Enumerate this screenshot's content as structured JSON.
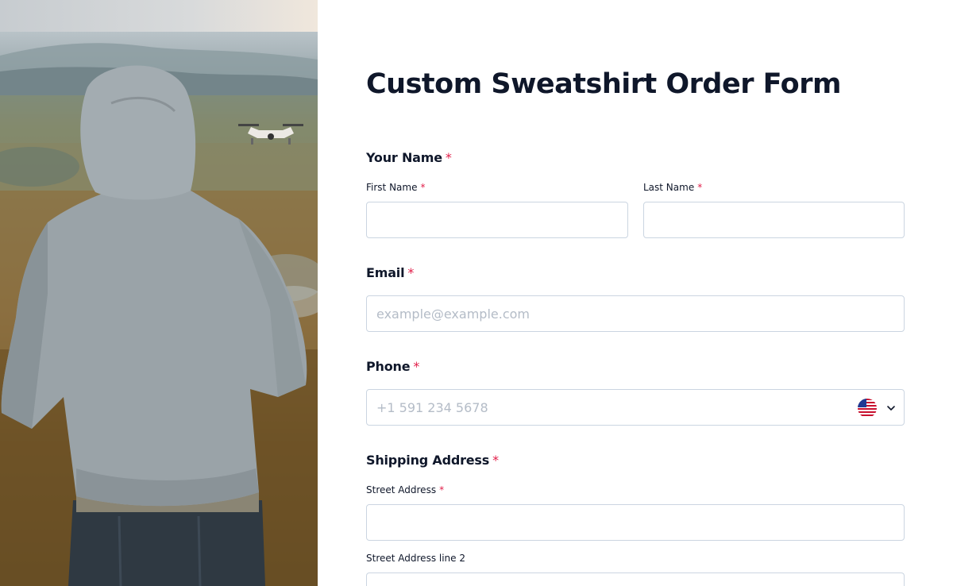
{
  "form": {
    "title": "Custom Sweatshirt Order Form",
    "required_mark": "*",
    "your_name": {
      "label": "Your Name",
      "first_name": {
        "label": "First Name",
        "value": "",
        "placeholder": ""
      },
      "last_name": {
        "label": "Last Name",
        "value": "",
        "placeholder": ""
      }
    },
    "email": {
      "label": "Email",
      "value": "",
      "placeholder": "example@example.com"
    },
    "phone": {
      "label": "Phone",
      "value": "",
      "placeholder": "+1 591 234 5678",
      "country_icon": "us-flag-icon"
    },
    "shipping_address": {
      "label": "Shipping Address",
      "street_address": {
        "label": "Street Address",
        "value": ""
      },
      "street_address_2": {
        "label": "Street Address line 2",
        "value": ""
      }
    }
  },
  "colors": {
    "required": "#e11d48",
    "text": "#0f172a",
    "border": "#cbd5e1",
    "placeholder": "#b4bcc7"
  }
}
